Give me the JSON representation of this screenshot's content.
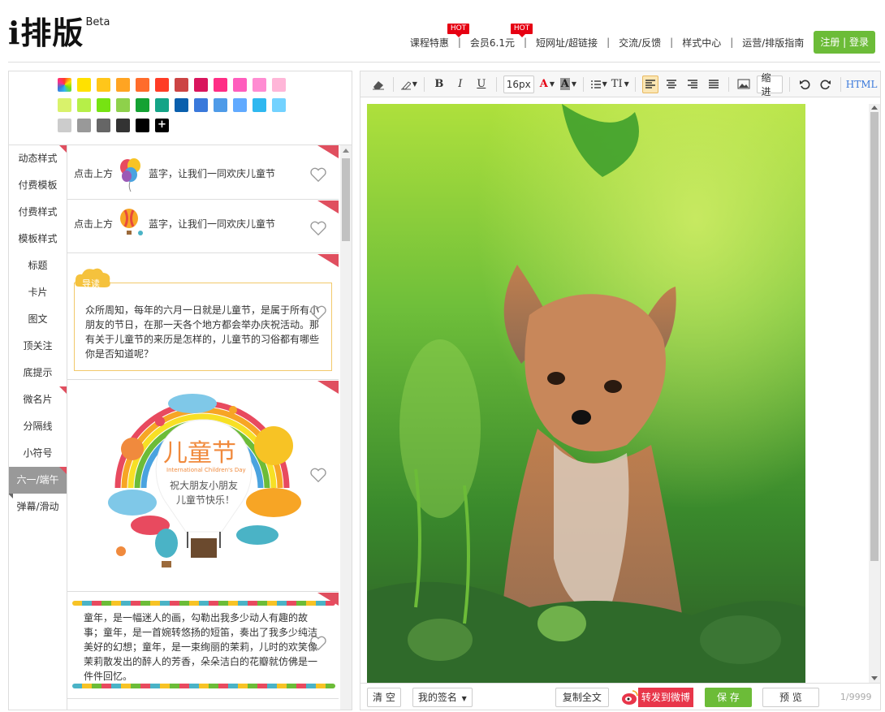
{
  "header": {
    "brand": "i排版",
    "beta": "Beta",
    "nav": [
      {
        "label": "课程特惠",
        "hot": "HOT"
      },
      {
        "label": "会员6.1元",
        "hot": "HOT"
      },
      {
        "label": "短网址/超链接"
      },
      {
        "label": "交流/反馈"
      },
      {
        "label": "样式中心"
      },
      {
        "label": "运营/排版指南"
      }
    ],
    "separator": "|",
    "login": "注册 | 登录"
  },
  "colors": {
    "accent_green": "#6cbc38",
    "ribbon_red": "#e04f5f",
    "hot_red": "#e60012",
    "weibo_red": "#e8364a",
    "palette": [
      [
        "#ffffff",
        "#ffe100",
        "#ffc61a",
        "#ffa422",
        "#ff6c2b",
        "#ff3c26",
        "#cc4444",
        "#d9155d",
        "#ff2d85",
        "#ff5dbd",
        "#ff8cd2",
        "#ffb6d8"
      ],
      [
        "#d9f26b",
        "#b6ef48",
        "#76e312",
        "#8ed14b",
        "#14a233",
        "#14a487",
        "#0a5fad",
        "#3a79db",
        "#4f9be8",
        "#61aaff",
        "#2fb8f0",
        "#73d2ff"
      ],
      [
        "#cccccc",
        "#999999",
        "#666666",
        "#333333",
        "#000000",
        "#000000"
      ]
    ]
  },
  "plus_label": "+",
  "categories": [
    "动态样式",
    "付费模板",
    "付费样式",
    "模板样式",
    "标题",
    "卡片",
    "图文",
    "顶关注",
    "底提示",
    "微名片",
    "分隔线",
    "小符号",
    "六一/端午",
    "弹幕/滑动"
  ],
  "templates": {
    "t1": {
      "left": "点击上方",
      "right": "蓝字，让我们一同欢庆儿童节"
    },
    "t2": {
      "left": "点击上方",
      "right": "蓝字，让我们一同欢庆儿童节"
    },
    "t3": {
      "badge": "导读",
      "body": "众所周知，每年的六月一日就是儿童节，是属于所有小朋友的节日，在那一天各个地方都会举办庆祝活动。那有关于儿童节的来历是怎样的，儿童节的习俗都有哪些你是否知道呢？"
    },
    "t4": {
      "title": "儿童节",
      "subtitle": "International Children's Day",
      "wish1": "祝大朋友小朋友",
      "wish2": "儿童节快乐！"
    },
    "t5": {
      "body": "童年，是一幅迷人的画，勾勒出我多少动人有趣的故事；童年，是一首婉转悠扬的短笛，奏出了我多少纯洁美好的幻想；童年，是一束绚丽的茉莉，儿时的欢笑像茉莉散发出的醉人的芳香，朵朵洁白的花瓣就仿佛是一件件回忆。"
    }
  },
  "toolbar": {
    "bold": "B",
    "italic": "I",
    "underline": "U",
    "font_size": "16px",
    "font_color": "A",
    "bg_color": "A",
    "text_size": "TI",
    "indent": "缩进",
    "html": "HTML"
  },
  "bottom": {
    "clear": "清 空",
    "signature": "我的签名",
    "copy": "复制全文",
    "weibo": "转发到微博",
    "save": "保 存",
    "preview": "预 览",
    "counter": "1/9999"
  }
}
